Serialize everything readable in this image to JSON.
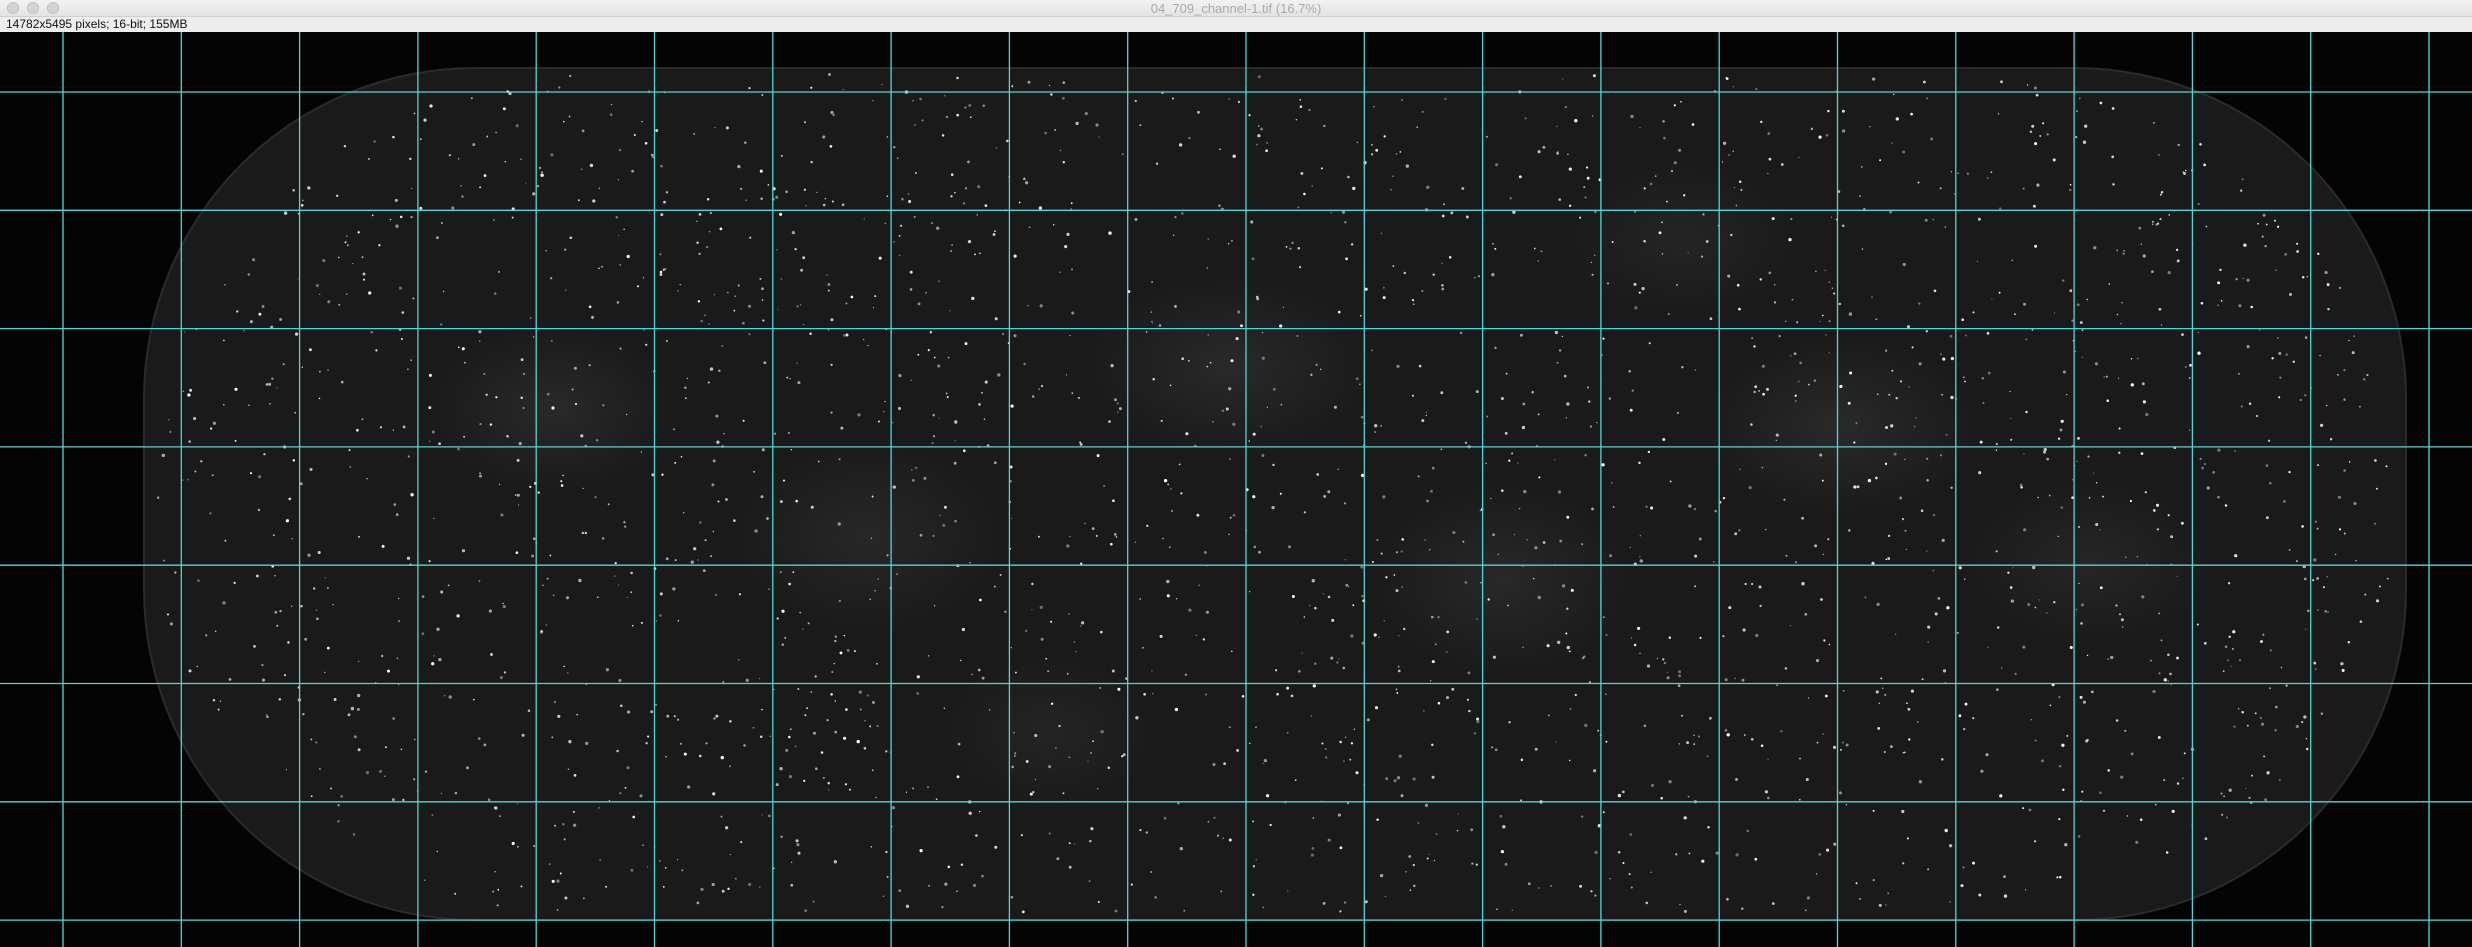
{
  "window": {
    "title": "04_709_channel-1.tif (16.7%)"
  },
  "image_info": {
    "text": "14782x5495 pixels; 16-bit; 155MB"
  },
  "overlay": {
    "grid_color": "#4fd6d6",
    "grid": "on"
  },
  "colors": {
    "canvas_background": "#040404",
    "speckle": "#ffffff"
  }
}
